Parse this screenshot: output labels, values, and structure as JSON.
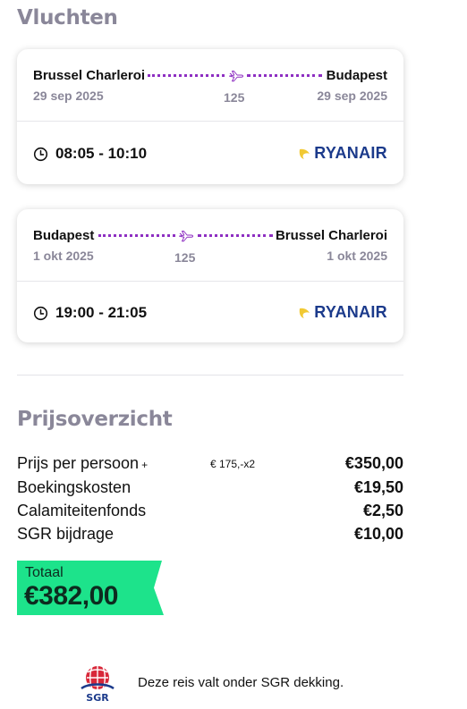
{
  "flights_section": {
    "title": "Vluchten"
  },
  "flights": [
    {
      "from_city": "Brussel Charleroi",
      "from_date": "29 sep 2025",
      "to_city": "Budapest",
      "to_date": "29 sep 2025",
      "number": "125",
      "time": "08:05 - 10:10",
      "airline": "RYANAIR"
    },
    {
      "from_city": "Budapest",
      "from_date": "1 okt 2025",
      "to_city": "Brussel Charleroi",
      "to_date": "1 okt 2025",
      "number": "125",
      "time": "19:00 - 21:05",
      "airline": "RYANAIR"
    }
  ],
  "price_section": {
    "title": "Prijsoverzicht",
    "rows": [
      {
        "label": "Prijs per persoon",
        "suffix": "+",
        "detail": "€ 175,-x2",
        "value": "€350,00"
      },
      {
        "label": "Boekingskosten",
        "value": "€19,50"
      },
      {
        "label": "Calamiteitenfonds",
        "value": "€2,50"
      },
      {
        "label": "SGR bijdrage",
        "value": "€10,00"
      }
    ],
    "total_label": "Totaal",
    "total_value": "€382,00"
  },
  "sgr": {
    "text": "Deze reis valt onder SGR dekking.",
    "logo_text": "SGR"
  },
  "colors": {
    "accent_purple": "#8e2fc2",
    "total_green": "#1de38b",
    "muted": "#8a8799",
    "airline_blue": "#1b3a8b",
    "airline_yellow": "#f1c933"
  }
}
